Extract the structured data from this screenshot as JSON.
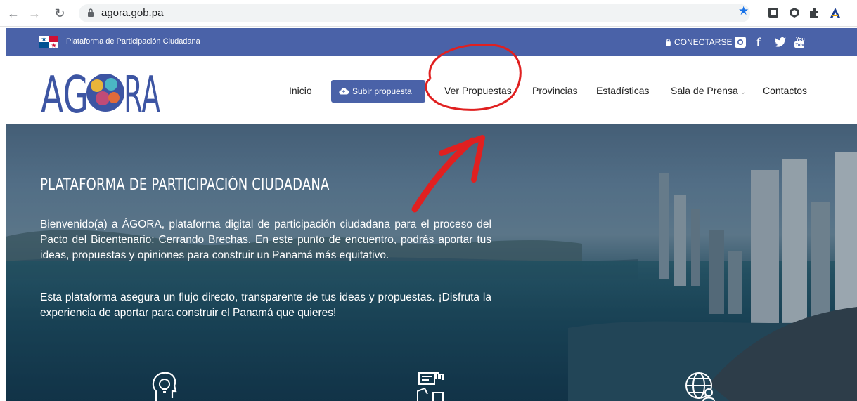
{
  "browser": {
    "url": "agora.gob.pa",
    "back_icon": "arrow-left-icon",
    "forward_icon": "arrow-right-icon",
    "reload_icon": "reload-icon"
  },
  "topbar": {
    "title": "Plataforma de Participación Ciudadana",
    "connect_label": "CONECTARSE",
    "color": "#4a62a8"
  },
  "nav": {
    "logo_text": "ÁGORA",
    "items": {
      "inicio": "Inicio",
      "subir": "Subir propuesta",
      "ver": "Ver Propuestas",
      "provincias": "Provincias",
      "estadisticas": "Estadísticas",
      "sala": "Sala de Prensa",
      "contactos": "Contactos"
    }
  },
  "hero": {
    "title": "PLATAFORMA DE PARTICIPACIÓN CIUDADANA",
    "paragraph1": "Bienvenido(a) a ÁGORA, plataforma digital de participación ciudadana para el proceso del Pacto del Bicentenario: Cerrando Brechas. En este punto de encuentro, podrás aportar tus ideas, propuestas y opiniones para construir un Panamá más equitativo.",
    "paragraph2": "Esta plataforma asegura un flujo directo, transparente de tus ideas y propuestas. ¡Disfruta la experiencia de aportar para construir el Panamá que quieres!"
  },
  "annotation_color": "#e02020"
}
